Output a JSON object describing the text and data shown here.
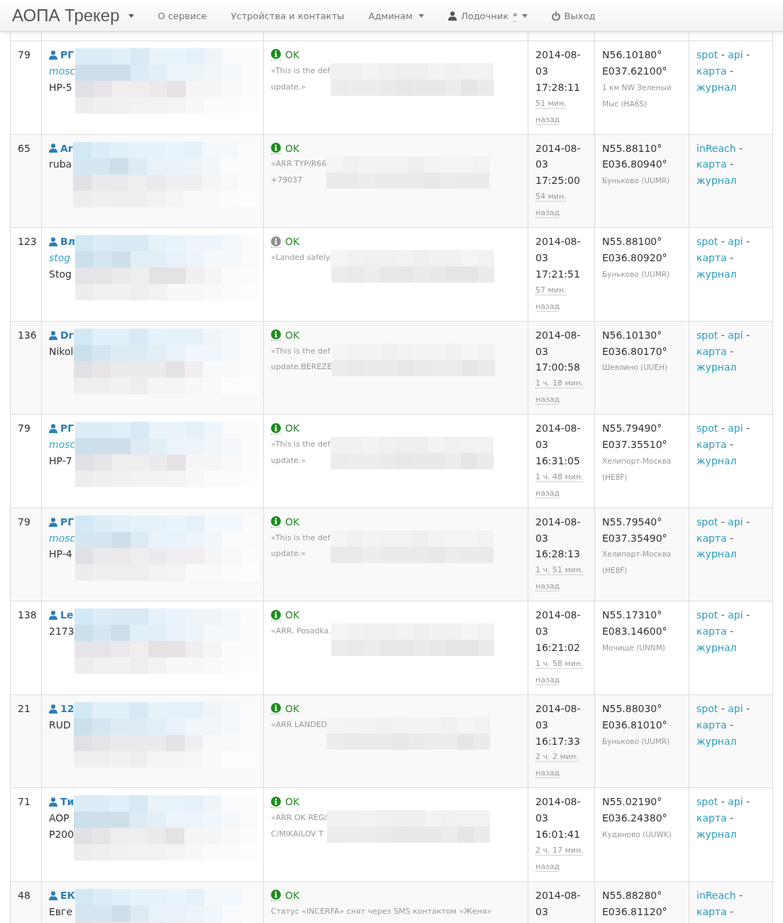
{
  "navbar": {
    "brand": "АОПА Трекер",
    "items": [
      {
        "kind": "link",
        "label": "О сервисе"
      },
      {
        "kind": "link",
        "label": "Устройства и контакты"
      },
      {
        "kind": "dropdown",
        "label": "Админам"
      },
      {
        "kind": "user",
        "label": "Лодочник",
        "badge": "*"
      },
      {
        "kind": "logout",
        "label": "Выход"
      }
    ]
  },
  "table": {
    "rows": [
      {
        "id": "79",
        "pilot": {
          "name": "РГ",
          "lines": [
            {
              "kind": "link",
              "text": "mosc"
            },
            {
              "kind": "plain",
              "text": "HP-5"
            }
          ],
          "redacted": true
        },
        "status": {
          "label": "OK",
          "color": "#1e8b1e",
          "message": [
            "«This is the def",
            "update.»"
          ],
          "redacted": true
        },
        "time": {
          "timestamp": "2014-08-03 17:28:11",
          "ago": "51 мин. назад"
        },
        "position": {
          "lat": "N56.10180°",
          "lon": "E037.62100°",
          "place": "1 км NW Зеленый Мыс (HA6S)"
        },
        "links": [
          {
            "label": "spot",
            "sep": "-"
          },
          {
            "label": "api",
            "sep": "-"
          },
          {
            "label": "карта",
            "sep": "-"
          },
          {
            "label": "журнал"
          }
        ]
      },
      {
        "id": "65",
        "pilot": {
          "name": "Ar",
          "lines": [
            {
              "kind": "plain",
              "text": "ruba"
            }
          ],
          "redacted": true
        },
        "status": {
          "label": "OK",
          "color": "#1e8b1e",
          "message": [
            "«ARR TYP/R66",
            "+79037"
          ],
          "redacted": true
        },
        "time": {
          "timestamp": "2014-08-03 17:25:00",
          "ago": "54 мин. назад"
        },
        "position": {
          "lat": "N55.88110°",
          "lon": "E036.80940°",
          "place": "Буньково (UUMR)"
        },
        "links": [
          {
            "label": "inReach",
            "sep": "-"
          },
          {
            "label": "карта",
            "sep": "-"
          },
          {
            "label": "журнал"
          }
        ]
      },
      {
        "id": "123",
        "pilot": {
          "name": "Вл",
          "lines": [
            {
              "kind": "link",
              "text": "stog"
            },
            {
              "kind": "plain",
              "text": "Stog"
            }
          ],
          "redacted": true
        },
        "status": {
          "label": "OK",
          "color": "#8c8c8c",
          "message": [
            "«Landed safely."
          ],
          "redacted": true
        },
        "time": {
          "timestamp": "2014-08-03 17:21:51",
          "ago": "57 мин. назад"
        },
        "position": {
          "lat": "N55.88100°",
          "lon": "E036.80920°",
          "place": "Буньково (UUMR)"
        },
        "links": [
          {
            "label": "spot",
            "sep": "-"
          },
          {
            "label": "api",
            "sep": "-"
          },
          {
            "label": "карта",
            "sep": "-"
          },
          {
            "label": "журнал"
          }
        ]
      },
      {
        "id": "136",
        "pilot": {
          "name": "Dr",
          "lines": [
            {
              "kind": "plain",
              "text": "Nikol"
            }
          ],
          "redacted": true
        },
        "status": {
          "label": "OK",
          "color": "#1e8b1e",
          "message": [
            "«This is the def",
            "update.BEREZE"
          ],
          "redacted": true
        },
        "time": {
          "timestamp": "2014-08-03 17:00:58",
          "ago": "1 ч. 18 мин. назад"
        },
        "position": {
          "lat": "N56.10130°",
          "lon": "E036.80170°",
          "place": "Шевлино (UUEH)"
        },
        "links": [
          {
            "label": "spot",
            "sep": "-"
          },
          {
            "label": "api",
            "sep": "-"
          },
          {
            "label": "карта",
            "sep": "-"
          },
          {
            "label": "журнал"
          }
        ]
      },
      {
        "id": "79",
        "pilot": {
          "name": "РГ",
          "lines": [
            {
              "kind": "link",
              "text": "mosc"
            },
            {
              "kind": "plain",
              "text": "HP-7"
            }
          ],
          "redacted": true
        },
        "status": {
          "label": "OK",
          "color": "#1e8b1e",
          "message": [
            "«This is the def",
            "update.»"
          ],
          "redacted": true
        },
        "time": {
          "timestamp": "2014-08-03 16:31:05",
          "ago": "1 ч. 48 мин. назад"
        },
        "position": {
          "lat": "N55.79490°",
          "lon": "E037.35510°",
          "place": "Хелипорт-Москва (HE8F)"
        },
        "links": [
          {
            "label": "spot",
            "sep": "-"
          },
          {
            "label": "api",
            "sep": "-"
          },
          {
            "label": "карта",
            "sep": "-"
          },
          {
            "label": "журнал"
          }
        ]
      },
      {
        "id": "79",
        "pilot": {
          "name": "РГ",
          "lines": [
            {
              "kind": "link",
              "text": "mosc"
            },
            {
              "kind": "plain",
              "text": "HP-4"
            }
          ],
          "redacted": true
        },
        "status": {
          "label": "OK",
          "color": "#1e8b1e",
          "message": [
            "«This is the def",
            "update.»"
          ],
          "redacted": true
        },
        "time": {
          "timestamp": "2014-08-03 16:28:13",
          "ago": "1 ч. 51 мин. назад"
        },
        "position": {
          "lat": "N55.79540°",
          "lon": "E037.35490°",
          "place": "Хелипорт-Москва (HE8F)"
        },
        "links": [
          {
            "label": "spot",
            "sep": "-"
          },
          {
            "label": "api",
            "sep": "-"
          },
          {
            "label": "карта",
            "sep": "-"
          },
          {
            "label": "журнал"
          }
        ]
      },
      {
        "id": "138",
        "pilot": {
          "name": "Le",
          "lines": [
            {
              "kind": "plain",
              "text": "2173"
            }
          ],
          "redacted": true
        },
        "status": {
          "label": "OK",
          "color": "#1e8b1e",
          "message": [
            "«ARR. Posadka."
          ],
          "redacted": true
        },
        "time": {
          "timestamp": "2014-08-03 16:21:02",
          "ago": "1 ч. 58 мин. назад"
        },
        "position": {
          "lat": "N55.17310°",
          "lon": "E083.14600°",
          "place": "Мочище (UNNM)"
        },
        "links": [
          {
            "label": "spot",
            "sep": "-"
          },
          {
            "label": "api",
            "sep": "-"
          },
          {
            "label": "карта",
            "sep": "-"
          },
          {
            "label": "журнал"
          }
        ]
      },
      {
        "id": "21",
        "pilot": {
          "name": "12",
          "lines": [
            {
              "kind": "plain",
              "text": "RUD"
            }
          ],
          "redacted": true
        },
        "status": {
          "label": "OK",
          "color": "#1e8b1e",
          "message": [
            "«ARR LANDED"
          ],
          "redacted": true
        },
        "time": {
          "timestamp": "2014-08-03 16:17:33",
          "ago": "2 ч. 2 мин. назад"
        },
        "position": {
          "lat": "N55.88030°",
          "lon": "E036.81010°",
          "place": "Буньково (UUMR)"
        },
        "links": [
          {
            "label": "spot",
            "sep": "-"
          },
          {
            "label": "api",
            "sep": "-"
          },
          {
            "label": "карта",
            "sep": "-"
          },
          {
            "label": "журнал"
          }
        ]
      },
      {
        "id": "71",
        "pilot": {
          "name": "Ти",
          "lines": [
            {
              "kind": "plain",
              "text": "AOP"
            },
            {
              "kind": "plain",
              "text": "P200"
            }
          ],
          "redacted": true
        },
        "status": {
          "label": "OK",
          "color": "#1e8b1e",
          "message": [
            "«ARR OK REG/",
            "C/MIKAILOV T"
          ],
          "redacted": true
        },
        "time": {
          "timestamp": "2014-08-03 16:01:41",
          "ago": "2 ч. 17 мин. назад"
        },
        "position": {
          "lat": "N55.02190°",
          "lon": "E036.24380°",
          "place": "Кудиново (UUWK)"
        },
        "links": [
          {
            "label": "spot",
            "sep": "-"
          },
          {
            "label": "api",
            "sep": "-"
          },
          {
            "label": "карта",
            "sep": "-"
          },
          {
            "label": "журнал"
          }
        ]
      },
      {
        "id": "48",
        "pilot": {
          "name": "ЕК",
          "lines": [
            {
              "kind": "plain",
              "text": "Евге"
            }
          ],
          "redacted": true
        },
        "status": {
          "label": "OK",
          "color": "#1e8b1e",
          "message": [
            "Статус «INCERFA» снят через SMS контактом «Женя»"
          ],
          "redacted": false
        },
        "time": {
          "timestamp": "2014-08-03"
        },
        "position": {
          "lat": "N55.88280°",
          "lon": "E036.81120°"
        },
        "links": [
          {
            "label": "inReach",
            "sep": "-"
          },
          {
            "label": "карта",
            "sep": "-"
          }
        ]
      }
    ]
  }
}
